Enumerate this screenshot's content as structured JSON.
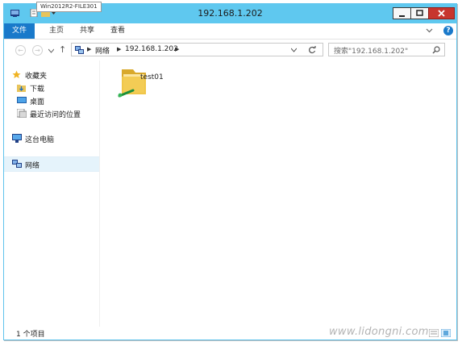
{
  "window": {
    "title": "192.168.1.202",
    "tooltip": "Win2012R2-FILE301"
  },
  "ribbon": {
    "tabs": [
      "文件",
      "主页",
      "共享",
      "查看"
    ]
  },
  "address": {
    "segments": [
      "网络",
      "192.168.1.202"
    ]
  },
  "search": {
    "placeholder": "搜索\"192.168.1.202\""
  },
  "nav": {
    "favorites_label": "收藏夹",
    "favorites": [
      "下载",
      "桌面",
      "最近访问的位置"
    ],
    "this_pc": "这台电脑",
    "network": "网络"
  },
  "content": {
    "items": [
      {
        "name": "test01",
        "icon": "shared-folder-icon"
      }
    ]
  },
  "status": {
    "count": "1 个项目"
  },
  "watermark": "www.lidongni.com",
  "colors": {
    "titlebar": "#5fc8ef",
    "file_tab": "#1979ca",
    "close_button": "#c7352d"
  }
}
